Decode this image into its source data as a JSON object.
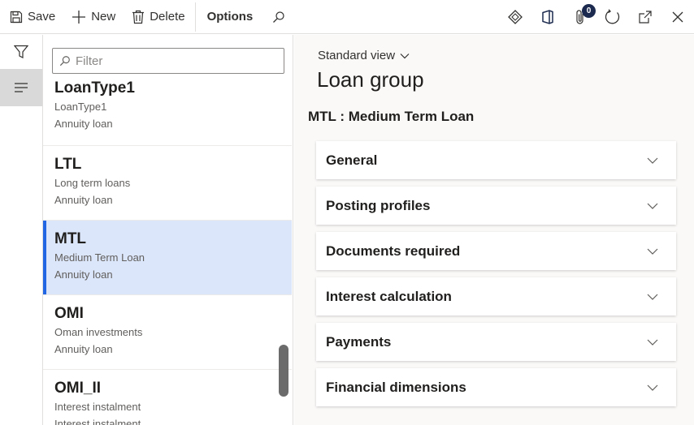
{
  "toolbar": {
    "save_label": "Save",
    "new_label": "New",
    "delete_label": "Delete",
    "options_label": "Options",
    "attachments_count": "0"
  },
  "filter": {
    "placeholder": "Filter"
  },
  "list": [
    {
      "title": "LoanType1",
      "line1": "LoanType1",
      "line2": "Annuity loan"
    },
    {
      "title": "LTL",
      "line1": "Long term loans",
      "line2": "Annuity loan"
    },
    {
      "title": "MTL",
      "line1": "Medium Term Loan",
      "line2": "Annuity loan"
    },
    {
      "title": "OMI",
      "line1": "Oman investments",
      "line2": "Annuity loan"
    },
    {
      "title": "OMI_II",
      "line1": "Interest instalment",
      "line2": "Interest instalment"
    }
  ],
  "main": {
    "view_label": "Standard view",
    "page_title": "Loan group",
    "record_title": "MTL : Medium Term Loan",
    "fasttabs": [
      {
        "label": "General"
      },
      {
        "label": "Posting profiles"
      },
      {
        "label": "Documents required"
      },
      {
        "label": "Interest calculation"
      },
      {
        "label": "Payments"
      },
      {
        "label": "Financial dimensions"
      }
    ]
  },
  "colors": {
    "accent": "#2266e3",
    "selected_row": "#dce6fa",
    "badge": "#1b2a4e"
  }
}
